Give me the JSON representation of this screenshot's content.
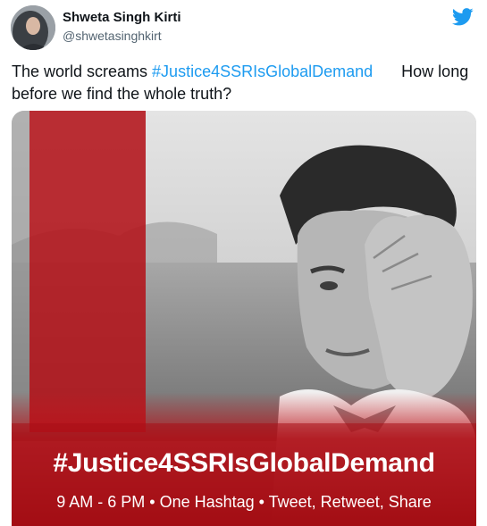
{
  "user": {
    "name": "Shweta Singh Kirti",
    "handle": "@shwetasinghkirt"
  },
  "tweet": {
    "text_before": "The world screams ",
    "hashtag": "#Justice4SSRIsGlobalDemand",
    "text_after": "How long before we find the whole truth?"
  },
  "media": {
    "banner_hashtag": "#Justice4SSRIsGlobalDemand",
    "banner_subtitle": "9 AM - 6 PM • One Hashtag • Tweet, Retweet, Share"
  },
  "colors": {
    "link": "#1d9bf0",
    "twitter_blue": "#1d9bf0",
    "banner_red": "#c8161d"
  },
  "icons": {
    "brand": "twitter-bird-icon"
  }
}
